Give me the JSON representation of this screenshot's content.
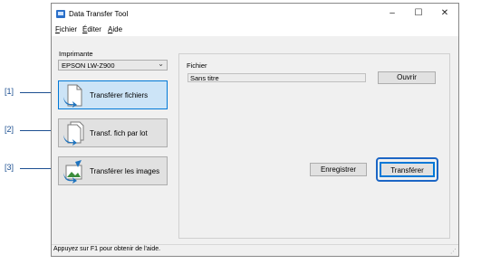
{
  "window": {
    "title": "Data Transfer Tool",
    "controls": {
      "minimize": "–",
      "maximize": "☐",
      "close": "✕"
    }
  },
  "menu": [
    {
      "accel": "F",
      "rest": "ichier"
    },
    {
      "accel": "É",
      "rest": "diter"
    },
    {
      "accel": "A",
      "rest": "ide"
    }
  ],
  "printer": {
    "label": "Imprimante",
    "selected": "EPSON LW-Z900"
  },
  "actions": [
    {
      "label": "Transférer fichiers",
      "icon": "file-transfer-icon",
      "selected": true
    },
    {
      "label": "Transf. fich par lot",
      "icon": "batch-transfer-icon",
      "selected": false
    },
    {
      "label": "Transférer les images",
      "icon": "image-transfer-icon",
      "selected": false
    }
  ],
  "file": {
    "label": "Fichier",
    "value": "Sans titre",
    "open_button": "Ouvrir"
  },
  "buttons": {
    "save": "Enregistrer",
    "transfer": "Transférer"
  },
  "status": {
    "text": "Appuyez sur F1 pour obtenir de l'aide."
  },
  "callouts": [
    "[1]",
    "[2]",
    "[3]"
  ],
  "colors": {
    "accent": "#0078d7",
    "callout": "#1c66c5",
    "icon_blue": "#1e73be"
  }
}
